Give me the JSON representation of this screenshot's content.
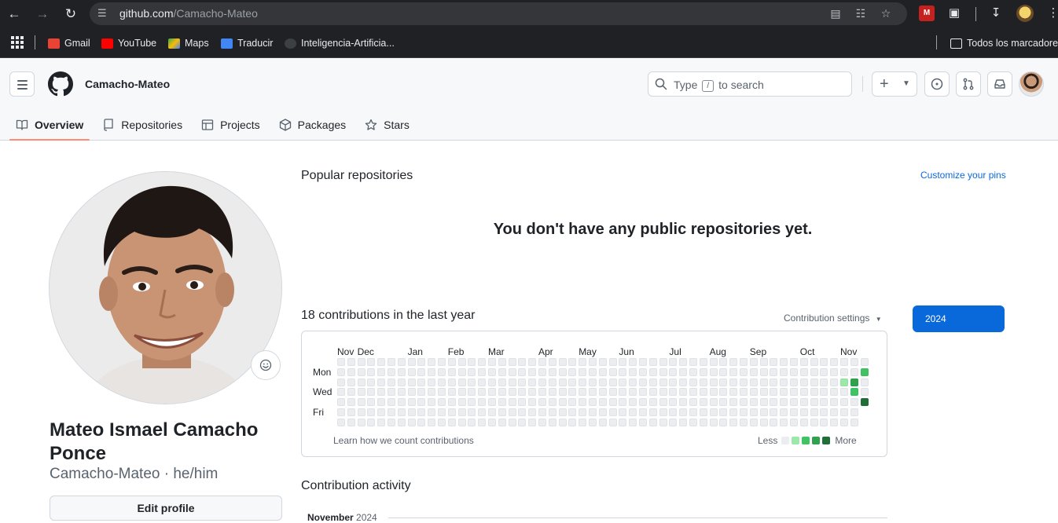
{
  "browser": {
    "url_host": "github.com",
    "url_path": "/Camacho-Mateo",
    "bookmarks": [
      {
        "label": "Gmail",
        "color": "#ea4335"
      },
      {
        "label": "YouTube",
        "color": "#ff0000"
      },
      {
        "label": "Maps",
        "color": "#34a853"
      },
      {
        "label": "Traducir",
        "color": "#4285f4"
      },
      {
        "label": "Inteligencia-Artificia...",
        "color": "#3c4043"
      }
    ],
    "all_bookmarks": "Todos los marcadores"
  },
  "header": {
    "username": "Camacho-Mateo",
    "search_type": "Type",
    "search_key": "/",
    "search_suffix": "to search",
    "plus_label": "+"
  },
  "tabs": [
    {
      "label": "Overview",
      "icon": "book-icon"
    },
    {
      "label": "Repositories",
      "icon": "repo-icon"
    },
    {
      "label": "Projects",
      "icon": "table-icon"
    },
    {
      "label": "Packages",
      "icon": "package-icon"
    },
    {
      "label": "Stars",
      "icon": "star-icon"
    }
  ],
  "profile": {
    "name": "Mateo Ismael Camacho Ponce",
    "login": "Camacho-Mateo",
    "pronouns": "he/him",
    "edit_label": "Edit profile"
  },
  "main": {
    "popular_title": "Popular repositories",
    "customize_label": "Customize your pins",
    "empty_message": "You don't have any public repositories yet.",
    "contrib_title": "18 contributions in the last year",
    "contrib_settings": "Contribution settings",
    "year_label": "2024",
    "learn_label": "Learn how we count contributions",
    "legend_less": "Less",
    "legend_more": "More",
    "activity_title": "Contribution activity",
    "activity_month": "November",
    "activity_year": "2024"
  },
  "graph": {
    "months": [
      "Nov",
      "Dec",
      "Jan",
      "Feb",
      "Mar",
      "Apr",
      "May",
      "Jun",
      "Jul",
      "Aug",
      "Sep",
      "Oct",
      "Nov"
    ],
    "weekday_labels": [
      {
        "day": 1,
        "label": "Mon"
      },
      {
        "day": 3,
        "label": "Wed"
      },
      {
        "day": 5,
        "label": "Fri"
      }
    ],
    "weeks": 53,
    "levels_colors": [
      "#ebedf0",
      "#9be9a8",
      "#40c463",
      "#30a14e",
      "#216e39"
    ],
    "active_cells": [
      {
        "week": 50,
        "day": 2,
        "level": 1
      },
      {
        "week": 51,
        "day": 2,
        "level": 3
      },
      {
        "week": 51,
        "day": 3,
        "level": 2
      },
      {
        "week": 52,
        "day": 1,
        "level": 2
      },
      {
        "week": 52,
        "day": 4,
        "level": 4
      }
    ],
    "last_week_days": 5
  }
}
